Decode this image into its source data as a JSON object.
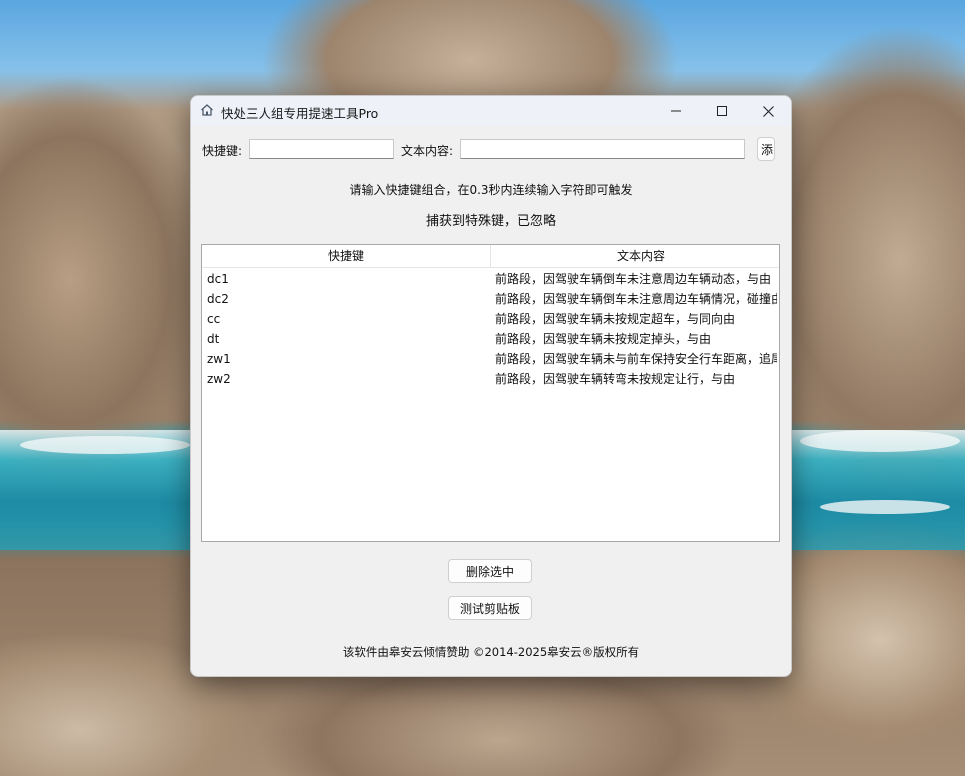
{
  "window": {
    "title": "快处三人组专用提速工具Pro"
  },
  "form": {
    "hotkey_label": "快捷键:",
    "hotkey_value": "",
    "text_label": "文本内容:",
    "text_value": "",
    "add_button_label": "添"
  },
  "hint": "请输入快捷键组合，在0.3秒内连续输入字符即可触发",
  "status": "捕获到特殊键，已忽略",
  "table": {
    "columns": [
      "快捷键",
      "文本内容"
    ],
    "rows": [
      {
        "key": "dc1",
        "text": "前路段，因驾驶车辆倒车未注意周边车辆动态，与由"
      },
      {
        "key": "dc2",
        "text": "前路段，因驾驶车辆倒车未注意周边车辆情况，碰撞由"
      },
      {
        "key": "cc",
        "text": "前路段，因驾驶车辆未按规定超车，与同向由"
      },
      {
        "key": "dt",
        "text": "前路段，因驾驶车辆未按规定掉头，与由"
      },
      {
        "key": "zw1",
        "text": "前路段，因驾驶车辆未与前车保持安全行车距离，追尾"
      },
      {
        "key": "zw2",
        "text": "前路段，因驾驶车辆转弯未按规定让行，与由"
      }
    ]
  },
  "buttons": {
    "delete_selected": "删除选中",
    "test_clipboard": "测试剪贴板"
  },
  "footer": "该软件由皋安云倾情赞助  ©2014-2025皋安云®版权所有"
}
